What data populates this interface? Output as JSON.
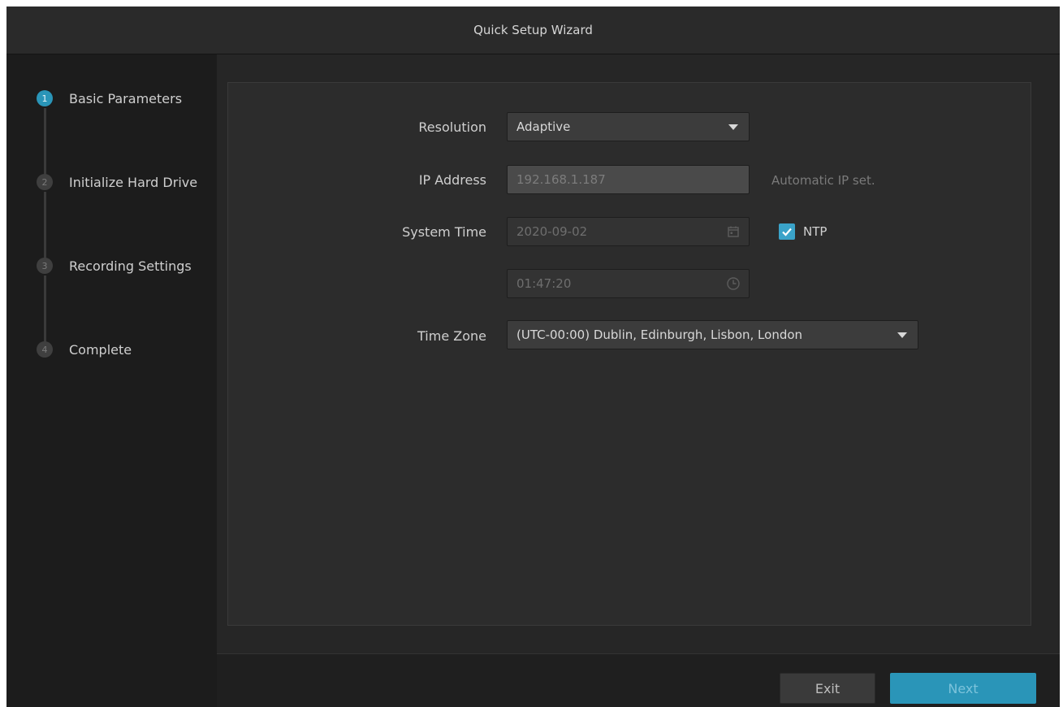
{
  "window": {
    "title": "Quick Setup Wizard"
  },
  "steps": [
    {
      "number": "1",
      "label": "Basic Parameters",
      "active": true
    },
    {
      "number": "2",
      "label": "Initialize Hard Drive",
      "active": false
    },
    {
      "number": "3",
      "label": "Recording Settings",
      "active": false
    },
    {
      "number": "4",
      "label": "Complete",
      "active": false
    }
  ],
  "form": {
    "resolution": {
      "label": "Resolution",
      "value": "Adaptive"
    },
    "ip_address": {
      "label": "IP Address",
      "value": "192.168.1.187",
      "hint": "Automatic IP set."
    },
    "system_time": {
      "label": "System Time",
      "date": "2020-09-02",
      "time": "01:47:20",
      "ntp_label": "NTP",
      "ntp_checked": true
    },
    "time_zone": {
      "label": "Time Zone",
      "value": "(UTC-00:00) Dublin, Edinburgh, Lisbon, London"
    }
  },
  "footer": {
    "exit_label": "Exit",
    "next_label": "Next"
  },
  "colors": {
    "accent": "#2a95b8",
    "checkbox": "#3aa3c9"
  },
  "icons": [
    "calendar-icon",
    "clock-icon",
    "chevron-down-icon",
    "checkmark-icon"
  ]
}
